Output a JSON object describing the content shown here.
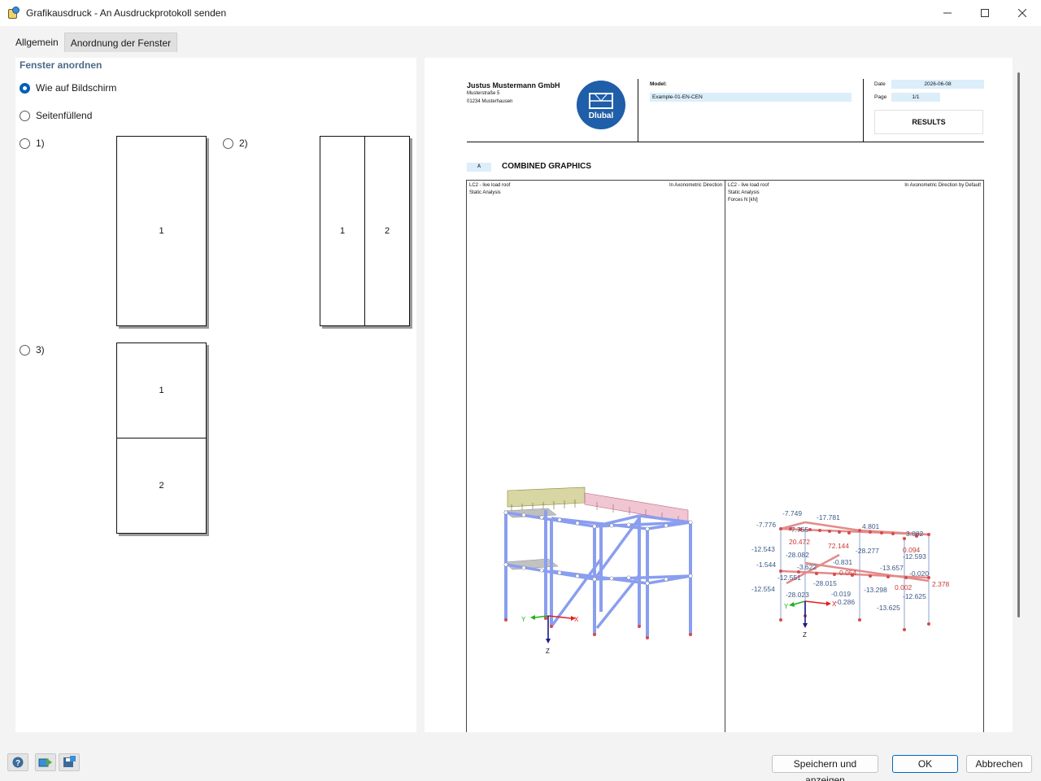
{
  "window": {
    "title": "Grafikausdruck - An Ausdruckprotokoll senden",
    "icon": "printer-icon"
  },
  "tabs": [
    {
      "label": "Allgemein",
      "active": false
    },
    {
      "label": "Anordnung der Fenster",
      "active": true
    }
  ],
  "left": {
    "section_title": "Fenster anordnen",
    "options": [
      {
        "label": "Wie auf Bildschirm",
        "checked": true
      },
      {
        "label": "Seitenfüllend",
        "checked": false
      },
      {
        "label": "1)",
        "checked": false
      },
      {
        "label": "2)",
        "checked": false
      },
      {
        "label": "3)",
        "checked": false
      }
    ],
    "layout1": {
      "cells": [
        "1"
      ]
    },
    "layout2": {
      "cells": [
        "1",
        "2"
      ]
    },
    "layout3": {
      "cells": [
        "1",
        "2"
      ]
    }
  },
  "preview": {
    "company": "Justus Mustermann GmbH",
    "street": "Musterstraße 5",
    "city": "01234 Musterhausen",
    "logo_text": "Dlubal",
    "model_label": "Model:",
    "model_value": "Example-01-EN-CEN",
    "date_label": "Date",
    "date_value": "2026-06-08",
    "page_label": "Page",
    "page_value": "1/1",
    "results": "RESULTS",
    "section_badge": "A",
    "section_title": "COMBINED GRAPHICS",
    "graphic1": {
      "line1": "LC2 - live load roof",
      "line2": "Static Analysis",
      "direction": "In Axonometric Direction",
      "axes": {
        "x": "X",
        "y": "Y",
        "z": "Z"
      }
    },
    "graphic2": {
      "line1": "LC2 - live load roof",
      "line2": "Static Analysis",
      "line3": "Forces N [kN]",
      "direction": "In Axonometric Direction by Default",
      "axes": {
        "x": "X",
        "y": "Y",
        "z": "Z"
      },
      "values_blue": [
        "-7.749",
        "-17.781",
        "-7.776",
        "-7.755",
        "4.801",
        "3.082",
        "-12.543",
        "-28.082",
        "-28.277",
        "-12.593",
        "-1.544",
        "-3.622",
        "-13.657",
        "-12.551",
        "-28.015",
        "-13.298",
        "-12.554",
        "-28.023",
        "-0.019",
        "-12.625",
        "-0.286",
        "-13.625",
        "-0.020",
        "-0.831"
      ],
      "values_red": [
        "20.472",
        "72.144",
        "0.094",
        "2.378",
        "0.054",
        "0.002"
      ]
    }
  },
  "bottom": {
    "tools": [
      "help-icon",
      "export-icon",
      "save-settings-icon"
    ],
    "save_show": "Speichern und anzeigen",
    "ok": "OK",
    "cancel": "Abbrechen"
  },
  "colors": {
    "accent": "#005fb8",
    "section_title": "#4a6a8a",
    "field_bg": "#dceefa",
    "member_blue": "#8a9ef0",
    "load_yellow": "#c8c58a",
    "load_pink": "#e8a0b8",
    "value_blue": "#3b5a86",
    "value_red": "#c83a3a"
  }
}
